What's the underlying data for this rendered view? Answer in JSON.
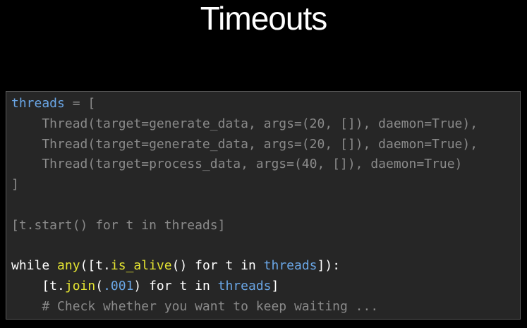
{
  "slide": {
    "title": "Timeouts"
  },
  "code": {
    "line1": {
      "var": "threads",
      "rest": " = ["
    },
    "line2": "    Thread(target=generate_data, args=(20, []), daemon=True),",
    "line3": "    Thread(target=generate_data, args=(20, []), daemon=True),",
    "line4": "    Thread(target=process_data, args=(40, []), daemon=True)",
    "line5": "]",
    "line6": "",
    "line7": "[t.start() for t in threads]",
    "line8": "",
    "line9": {
      "kw_while": "while ",
      "fn_any": "any",
      "p1": "([t.",
      "fn_is_alive": "is_alive",
      "p2": "() for t in ",
      "var_threads": "threads",
      "p3": "]):"
    },
    "line10": {
      "p1": "    [t.",
      "fn_join": "join",
      "p2": "(",
      "num": ".001",
      "p3": ") for t in ",
      "var_threads": "threads",
      "p4": "]"
    },
    "line11": "    # Check whether you want to keep waiting ..."
  },
  "colors": {
    "background": "#000000",
    "panel": "#262626",
    "muted_text": "#8a8a8a",
    "keyword_text": "#ffffff",
    "function_text": "#e5e532",
    "variable_text": "#6aa6e6"
  }
}
